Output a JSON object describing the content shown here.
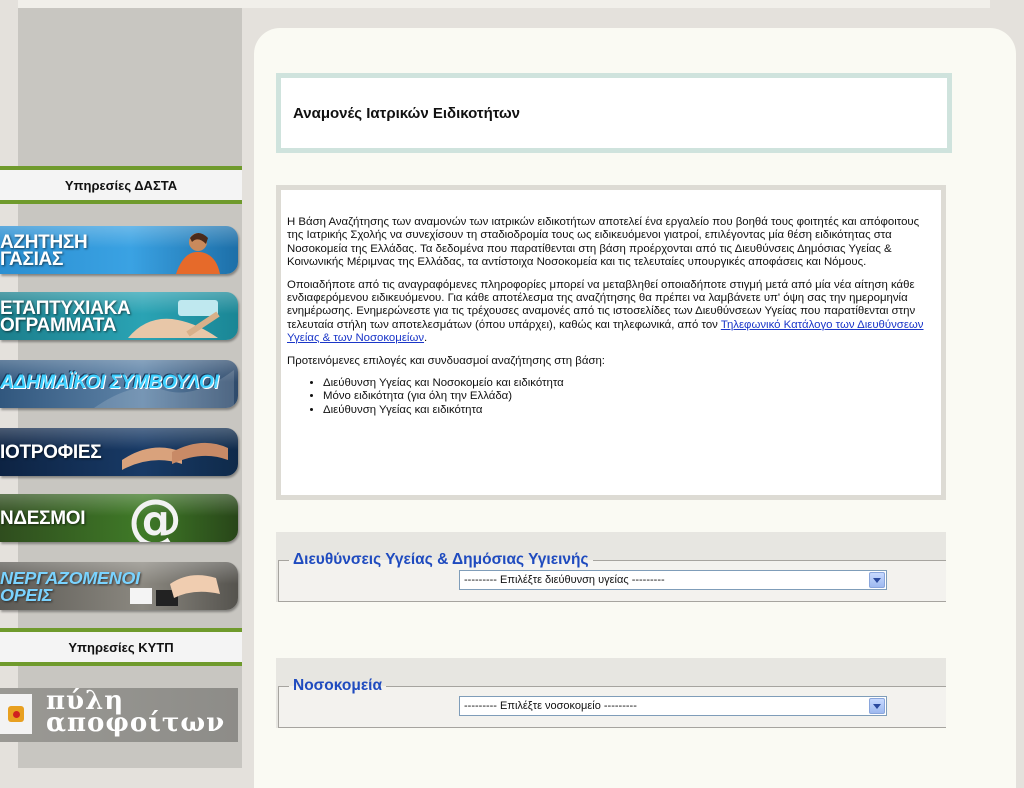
{
  "sidebar": {
    "header_dasta": "Υπηρεσίες ΔΑΣΤΑ",
    "banners": [
      {
        "label": "ΑΖΗΤΗΣΗ\nΓΑΣΙΑΣ",
        "icon": "job-search-icon"
      },
      {
        "label": "ΕΤΑΠΤΥΧΙΑΚΑ\nΟΓΡΑΜΜΑΤΑ",
        "icon": "postgraduate-icon"
      },
      {
        "label": "ΑΔΗΜΑΪΚΟΙ ΣΥΜΒΟΥΛΟΙ",
        "icon": "advisors-icon"
      },
      {
        "label": "ΙΟΤΡΟΦΙΕΣ",
        "icon": "scholarships-icon"
      },
      {
        "label": "ΝΔΕΣΜΟΙ",
        "icon": "at-sign-icon"
      },
      {
        "label": "ΝΕΡΓΑΖΟΜΕΝΟΙ\nΟΡΕΙΣ",
        "icon": "partners-icon"
      }
    ],
    "header_kytp": "Υπηρεσίες ΚΥΤΠ",
    "portal_label": "πύλη\nαποφοίτων",
    "portal_logo": "university-crest-icon"
  },
  "main": {
    "title": "Αναμονές Ιατρικών Ειδικοτήτων",
    "intro_p1": "Η Βάση Αναζήτησης των αναμονών των ιατρικών ειδικοτήτων αποτελεί ένα εργαλείο που βοηθά τους φοιτητές και απόφοιτους της Ιατρικής Σχολής να συνεχίσουν τη σταδιοδρομία τους ως ειδικευόμενοι γιατροί, επιλέγοντας μία θέση ειδικότητας στα Νοσοκομεία της Ελλάδας. Τα δεδομένα που παρατίθενται στη βάση προέρχονται από τις Διευθύνσεις Δημόσιας Υγείας & Κοινωνικής Μέριμνας της Ελλάδας, τα αντίστοιχα Νοσοκομεία και τις τελευταίες υπουργικές αποφάσεις και Νόμους.",
    "intro_p2_text": "Οποιαδήποτε από τις αναγραφόμενες πληροφορίες μπορεί να μεταβληθεί οποιαδήποτε στιγμή μετά από μία νέα αίτηση κάθε ενδιαφερόμενου ειδικευόμενου. Για κάθε αποτέλεσμα της αναζήτησης θα πρέπει να λαμβάνετε υπ' όψη σας την ημερομηνία ενημέρωσης. Ενημερώνεστε για τις τρέχουσες αναμονές από τις ιστοσελίδες των Διευθύνσεων Υγείας που παρατίθενται στην τελευταία στήλη των αποτελεσμάτων (όπου υπάρχει), καθώς και τηλεφωνικά, από τον ",
    "intro_p2_link": "Τηλεφωνικό Κατάλογο των Διευθύνσεων Υγείας & των Νοσοκομείων",
    "intro_p2_end": ".",
    "options_heading": "Προτεινόμενες επιλογές και συνδυασμοί αναζήτησης στη βάση:",
    "options": [
      "Διεύθυνση Υγείας και Νοσοκομείο και ειδικότητα",
      "Μόνο ειδικότητα (για όλη την Ελλάδα)",
      "Διεύθυνση Υγείας και ειδικότητα"
    ]
  },
  "filters": {
    "health_directorate": {
      "legend": "Διευθύνσεις Υγείας & Δημόσιας Υγιεινής",
      "selected": "--------- Επιλέξτε διεύθυνση υγείας ---------"
    },
    "hospitals": {
      "legend": "Νοσοκομεία",
      "selected": "--------- Επιλέξτε νοσοκομείο ---------"
    }
  },
  "colors": {
    "accent_green": "#6f9a2c",
    "legend_blue": "#1f4bbf",
    "link_blue": "#1a36c8"
  }
}
